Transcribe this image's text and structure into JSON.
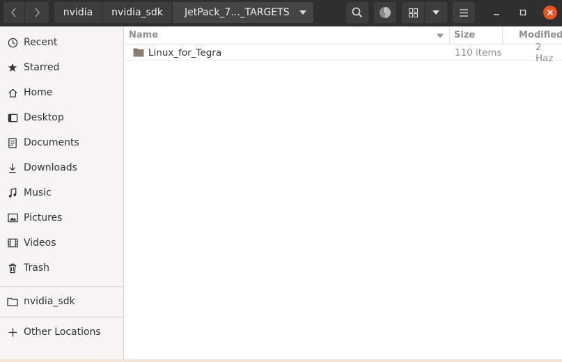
{
  "breadcrumbs": [
    "nvidia",
    "nvidia_sdk",
    "JetPack_7..._TARGETS"
  ],
  "sidebar": {
    "items": [
      {
        "label": "Recent",
        "icon": "clock-icon"
      },
      {
        "label": "Starred",
        "icon": "star-icon"
      },
      {
        "label": "Home",
        "icon": "home-icon"
      },
      {
        "label": "Desktop",
        "icon": "desktop-icon"
      },
      {
        "label": "Documents",
        "icon": "document-icon"
      },
      {
        "label": "Downloads",
        "icon": "download-icon"
      },
      {
        "label": "Music",
        "icon": "music-icon"
      },
      {
        "label": "Pictures",
        "icon": "picture-icon"
      },
      {
        "label": "Videos",
        "icon": "video-icon"
      },
      {
        "label": "Trash",
        "icon": "trash-icon"
      }
    ],
    "bookmarks": [
      {
        "label": "nvidia_sdk",
        "icon": "folder-icon"
      }
    ],
    "other": {
      "label": "Other Locations",
      "icon": "plus-icon"
    }
  },
  "columns": {
    "name": "Name",
    "size": "Size",
    "modified": "Modified"
  },
  "files": [
    {
      "name": "Linux_for_Tegra",
      "size": "110 items",
      "modified": "2 Haz",
      "icon": "folder-icon"
    }
  ],
  "colors": {
    "headerbar": "#2f2f2f",
    "close_button": "#e95420",
    "folder": "#7a6e68"
  }
}
